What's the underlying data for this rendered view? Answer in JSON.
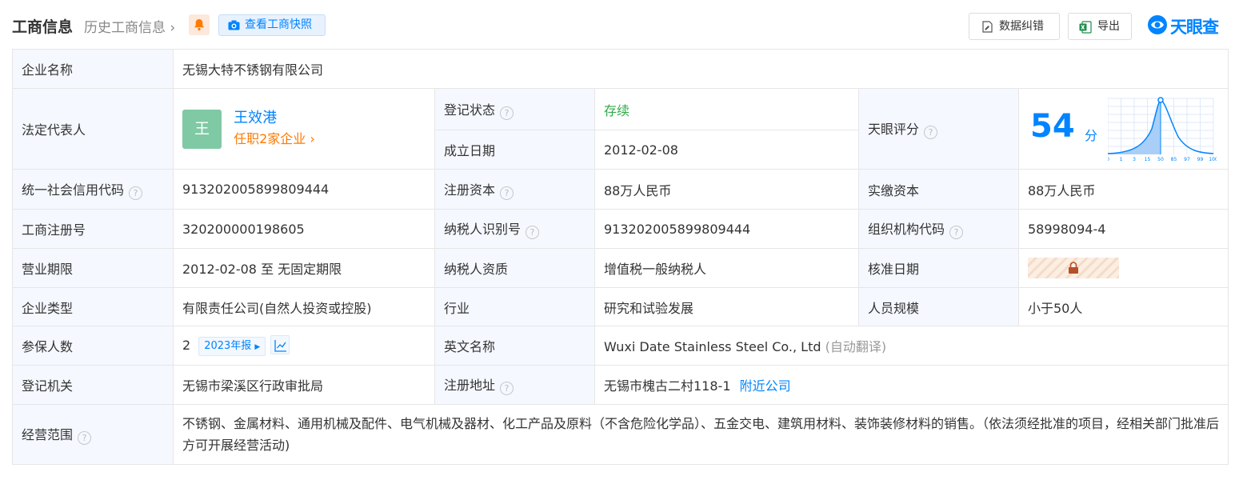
{
  "header": {
    "title": "工商信息",
    "history": "历史工商信息",
    "snapshot": "查看工商快照",
    "correct": "数据纠错",
    "export": "导出",
    "logo": "天眼查"
  },
  "rows": {
    "company_name": {
      "label": "企业名称",
      "value": "无锡大特不锈钢有限公司"
    },
    "legal_rep": {
      "label": "法定代表人",
      "avatar": "王",
      "name": "王效港",
      "jobs": "任职2家企业"
    },
    "reg_status": {
      "label": "登记状态",
      "value": "存续"
    },
    "found_date": {
      "label": "成立日期",
      "value": "2012-02-08"
    },
    "score": {
      "label": "天眼评分",
      "value": "54",
      "unit": "分",
      "axis": [
        "0",
        "1",
        "3",
        "15",
        "50",
        "85",
        "97",
        "99",
        "100"
      ]
    },
    "credit_code": {
      "label": "统一社会信用代码",
      "value": "913202005899809444"
    },
    "reg_capital": {
      "label": "注册资本",
      "value": "88万人民币"
    },
    "paid_capital": {
      "label": "实缴资本",
      "value": "88万人民币"
    },
    "reg_no": {
      "label": "工商注册号",
      "value": "320200000198605"
    },
    "taxpayer_id": {
      "label": "纳税人识别号",
      "value": "913202005899809444"
    },
    "org_code": {
      "label": "组织机构代码",
      "value": "58998094-4"
    },
    "term": {
      "label": "营业期限",
      "value": "2012-02-08 至 无固定期限"
    },
    "taxpayer_qual": {
      "label": "纳税人资质",
      "value": "增值税一般纳税人"
    },
    "approve_date": {
      "label": "核准日期"
    },
    "company_type": {
      "label": "企业类型",
      "value": "有限责任公司(自然人投资或控股)"
    },
    "industry": {
      "label": "行业",
      "value": "研究和试验发展"
    },
    "staff_size": {
      "label": "人员规模",
      "value": "小于50人"
    },
    "insured": {
      "label": "参保人数",
      "value": "2",
      "report": "2023年报"
    },
    "english_name": {
      "label": "英文名称",
      "value": "Wuxi Date Stainless Steel Co., Ltd",
      "note": "(自动翻译)"
    },
    "authority": {
      "label": "登记机关",
      "value": "无锡市梁溪区行政审批局"
    },
    "address": {
      "label": "注册地址",
      "value": "无锡市槐古二村118-1",
      "nearby": "附近公司"
    },
    "scope": {
      "label": "经营范围",
      "value": "不锈钢、金属材料、通用机械及配件、电气机械及器材、化工产品及原料（不含危险化学品）、五金交电、建筑用材料、装饰装修材料的销售。（依法须经批准的项目，经相关部门批准后方可开展经营活动)"
    }
  },
  "colors": {
    "accent": "#0084ff",
    "status": "#2faa48",
    "jobs": "#ff7a00",
    "label_bg": "#f5f8fe"
  }
}
